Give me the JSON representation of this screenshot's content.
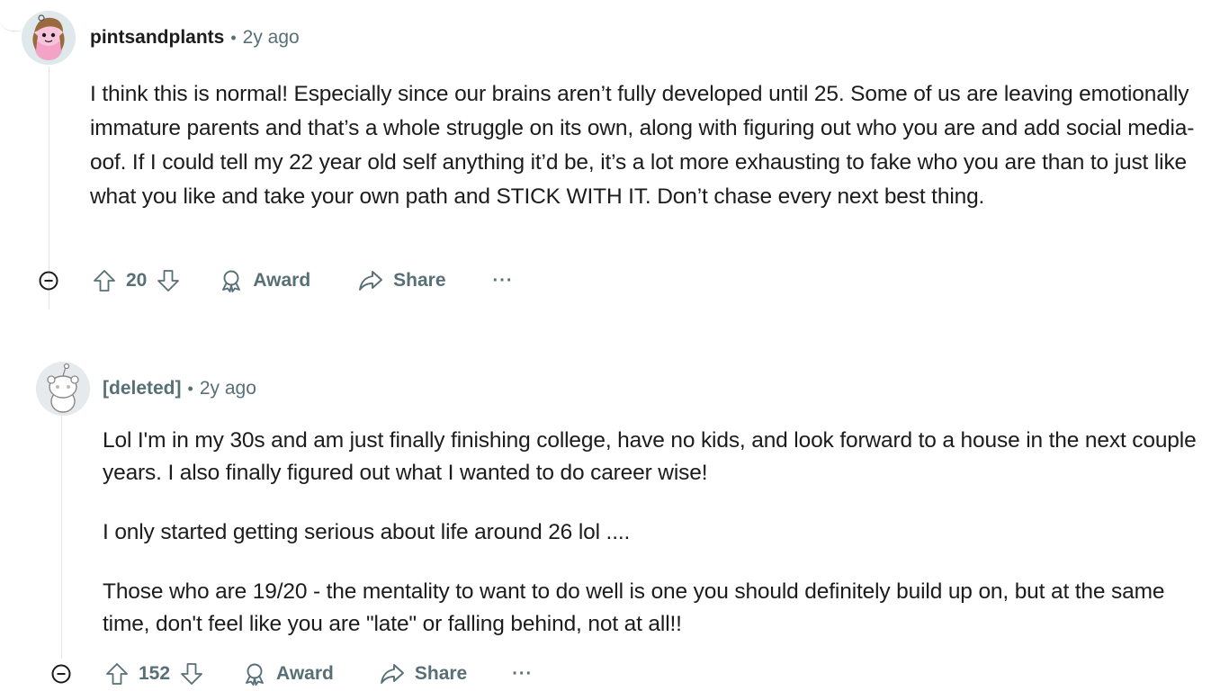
{
  "comments": [
    {
      "author": "pintsandplants",
      "separator": "•",
      "time": "2y ago",
      "paragraphs": [
        "I think this is normal! Especially since our brains aren’t fully developed until 25. Some of us are leaving emotionally immature parents and that’s a whole struggle on its own, along with figuring out who you are and add social media- oof. If I could tell my 22 year old self anything it’d be, it’s a lot more exhausting to fake who you are than to just like what you like and take your own path and STICK WITH IT. Don’t chase every next best thing."
      ],
      "votes": "20",
      "award_label": "Award",
      "share_label": "Share",
      "more_label": "···"
    },
    {
      "author": "[deleted]",
      "separator": "•",
      "time": "2y ago",
      "paragraphs": [
        "Lol I'm in my 30s and am just finally finishing college, have no kids, and look forward to a house in the next couple years. I also finally figured out what I wanted to do career wise!",
        "I only started getting serious about life around 26 lol ....",
        "Those who are 19/20 - the mentality to want to do well is one you should definitely build up on, but at the same time, don't feel like you are \"late\" or falling behind, not at all!!"
      ],
      "votes": "152",
      "award_label": "Award",
      "share_label": "Share",
      "more_label": "···"
    }
  ],
  "icons": {
    "collapse": "collapse-icon",
    "upvote": "upvote-arrow-icon",
    "downvote": "downvote-arrow-icon",
    "award": "award-icon",
    "share": "share-icon"
  },
  "colors": {
    "meta_gray": "#576f76",
    "text": "#1c1c1c",
    "thread_line": "#e5e5e5"
  }
}
